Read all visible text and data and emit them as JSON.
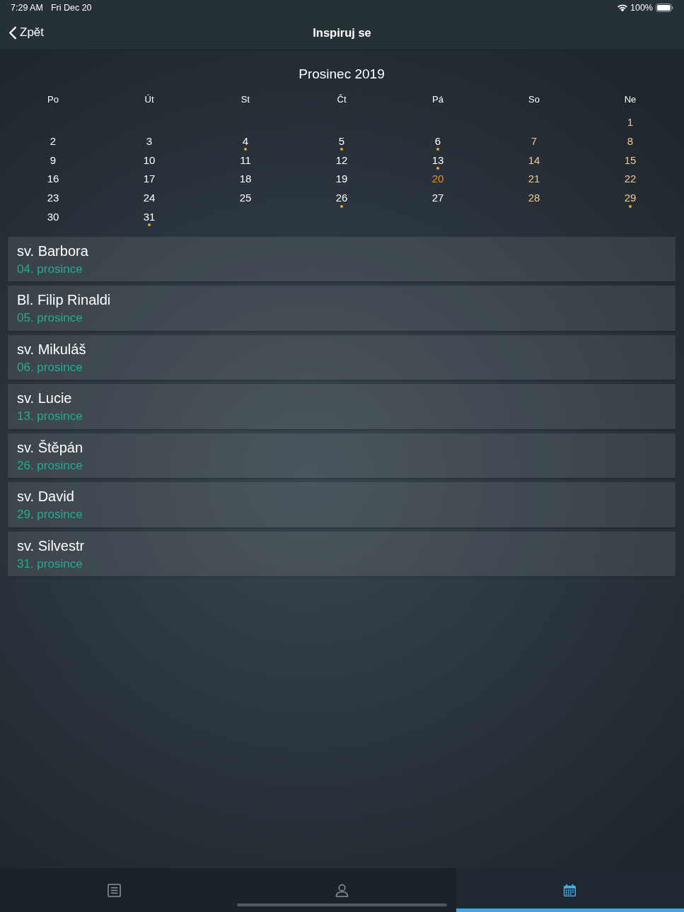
{
  "status_bar": {
    "time": "7:29 AM",
    "date": "Fri Dec 20",
    "battery": "100%"
  },
  "nav_bar": {
    "back": "Zpět",
    "title": "Inspiruj se"
  },
  "calendar": {
    "title": "Prosinec 2019",
    "weekdays": [
      "Po",
      "Út",
      "St",
      "Čt",
      "Pá",
      "So",
      "Ne"
    ],
    "weeks": [
      [
        {
          "day": "1",
          "kind": "weekend",
          "marked": false
        }
      ],
      [
        {
          "day": "2",
          "kind": "weekday",
          "marked": false
        },
        {
          "day": "3",
          "kind": "weekday",
          "marked": false
        },
        {
          "day": "4",
          "kind": "weekday",
          "marked": true
        },
        {
          "day": "5",
          "kind": "weekday",
          "marked": true
        },
        {
          "day": "6",
          "kind": "weekday",
          "marked": true
        },
        {
          "day": "7",
          "kind": "weekend",
          "marked": false
        },
        {
          "day": "8",
          "kind": "weekend",
          "marked": false
        }
      ],
      [
        {
          "day": "9",
          "kind": "weekday",
          "marked": false
        },
        {
          "day": "10",
          "kind": "weekday",
          "marked": false
        },
        {
          "day": "11",
          "kind": "weekday",
          "marked": false
        },
        {
          "day": "12",
          "kind": "weekday",
          "marked": false
        },
        {
          "day": "13",
          "kind": "weekday",
          "marked": true
        },
        {
          "day": "14",
          "kind": "weekend",
          "marked": false
        },
        {
          "day": "15",
          "kind": "weekend",
          "marked": false
        }
      ],
      [
        {
          "day": "16",
          "kind": "weekday",
          "marked": false
        },
        {
          "day": "17",
          "kind": "weekday",
          "marked": false
        },
        {
          "day": "18",
          "kind": "weekday",
          "marked": false
        },
        {
          "day": "19",
          "kind": "weekday",
          "marked": false
        },
        {
          "day": "20",
          "kind": "today",
          "marked": false
        },
        {
          "day": "21",
          "kind": "weekend",
          "marked": false
        },
        {
          "day": "22",
          "kind": "weekend",
          "marked": false
        }
      ],
      [
        {
          "day": "23",
          "kind": "weekday",
          "marked": false
        },
        {
          "day": "24",
          "kind": "weekday",
          "marked": false
        },
        {
          "day": "25",
          "kind": "weekday",
          "marked": false
        },
        {
          "day": "26",
          "kind": "weekday",
          "marked": true
        },
        {
          "day": "27",
          "kind": "weekday",
          "marked": false
        },
        {
          "day": "28",
          "kind": "weekend",
          "marked": false
        },
        {
          "day": "29",
          "kind": "weekend",
          "marked": true
        }
      ],
      [
        {
          "day": "30",
          "kind": "weekday",
          "marked": false
        },
        {
          "day": "31",
          "kind": "weekday",
          "marked": true
        }
      ]
    ]
  },
  "events": [
    {
      "name": "sv. Barbora",
      "date": "04. prosince"
    },
    {
      "name": "Bl. Filip Rinaldi",
      "date": "05. prosince"
    },
    {
      "name": "sv. Mikuláš",
      "date": "06. prosince"
    },
    {
      "name": "sv. Lucie",
      "date": "13. prosince"
    },
    {
      "name": "sv. Štěpán",
      "date": "26. prosince"
    },
    {
      "name": "sv. David",
      "date": "29. prosince"
    },
    {
      "name": "sv. Silvestr",
      "date": "31. prosince"
    }
  ],
  "tab_bar": {
    "tabs": [
      {
        "kind": "list",
        "selected": false
      },
      {
        "kind": "person",
        "selected": false
      },
      {
        "kind": "calendar",
        "selected": true
      }
    ]
  }
}
